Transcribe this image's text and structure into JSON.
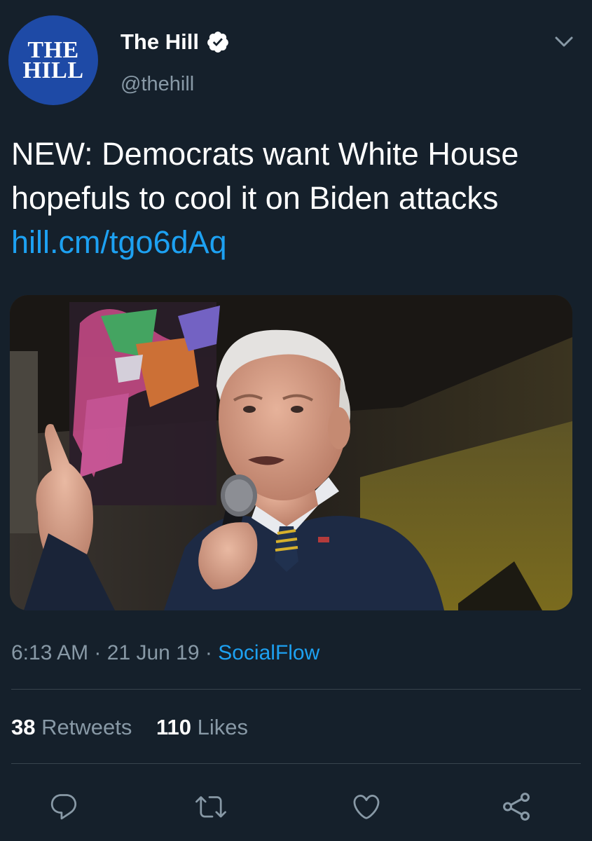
{
  "account": {
    "avatar_line1": "THE",
    "avatar_line2": "HILL",
    "display_name": "The Hill",
    "handle": "@thehill",
    "verified": true
  },
  "tweet": {
    "text": "NEW: Democrats want White House hopefuls to cool it on Biden attacks",
    "link_text": "hill.cm/tgo6dAq"
  },
  "meta": {
    "time": "6:13 AM",
    "separator": "·",
    "date": "21 Jun 19",
    "source": "SocialFlow"
  },
  "stats": {
    "retweets_count": "38",
    "retweets_label": "Retweets",
    "likes_count": "110",
    "likes_label": "Likes"
  },
  "icons": {
    "reply": "reply-icon",
    "retweet": "retweet-icon",
    "like": "heart-icon",
    "share": "share-icon",
    "verified": "verified-badge-icon",
    "caret": "chevron-down-icon"
  },
  "colors": {
    "background": "#15202b",
    "link": "#1da1f2",
    "secondary_text": "#8899a6",
    "avatar_bg": "#1e4aa6",
    "divider": "#38444d"
  }
}
